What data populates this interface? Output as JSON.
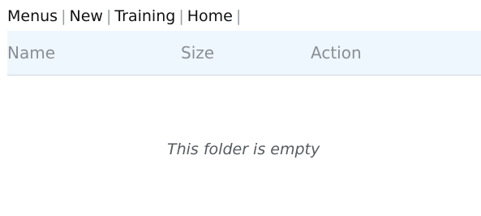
{
  "breadcrumb": {
    "items": [
      {
        "label": "Menus"
      },
      {
        "label": "New"
      },
      {
        "label": "Training"
      },
      {
        "label": "Home"
      }
    ],
    "separator": "|"
  },
  "table": {
    "headers": {
      "name": "Name",
      "size": "Size",
      "action": "Action"
    },
    "empty_message": "This folder is empty"
  }
}
